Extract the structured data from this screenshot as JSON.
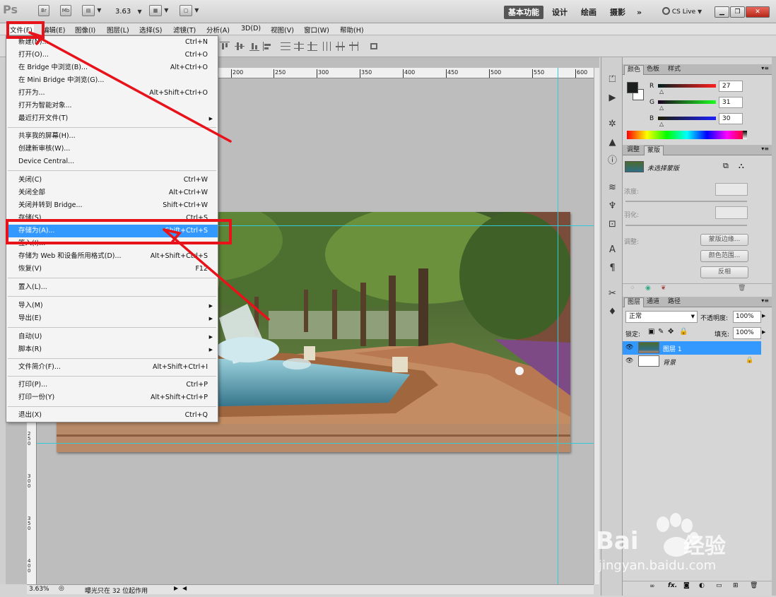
{
  "appbar": {
    "logo": "Ps",
    "br_button": "Br",
    "mb_button": "Mb",
    "zoom": "3.63",
    "workspaces": [
      "基本功能",
      "设计",
      "绘画",
      "摄影"
    ],
    "more": "»",
    "cs_live": "CS Live"
  },
  "menubar": {
    "items": [
      "文件(F)",
      "编辑(E)",
      "图像(I)",
      "图层(L)",
      "选择(S)",
      "滤镜(T)",
      "分析(A)",
      "3D(D)",
      "视图(V)",
      "窗口(W)",
      "帮助(H)"
    ]
  },
  "file_menu": {
    "items": [
      {
        "label": "新建(N)...",
        "shortcut": "Ctrl+N"
      },
      {
        "label": "打开(O)...",
        "shortcut": "Ctrl+O"
      },
      {
        "label": "在 Bridge 中浏览(B)...",
        "shortcut": "Alt+Ctrl+O"
      },
      {
        "label": "在 Mini Bridge 中浏览(G)...",
        "shortcut": ""
      },
      {
        "label": "打开为...",
        "shortcut": "Alt+Shift+Ctrl+O"
      },
      {
        "label": "打开为智能对象...",
        "shortcut": ""
      },
      {
        "label": "最近打开文件(T)",
        "shortcut": "",
        "submenu": true
      },
      {
        "label": "共享我的屏幕(H)...",
        "shortcut": ""
      },
      {
        "label": "创建新审核(W)...",
        "shortcut": ""
      },
      {
        "label": "Device Central...",
        "shortcut": ""
      },
      {
        "label": "关闭(C)",
        "shortcut": "Ctrl+W"
      },
      {
        "label": "关闭全部",
        "shortcut": "Alt+Ctrl+W"
      },
      {
        "label": "关闭并转到 Bridge...",
        "shortcut": "Shift+Ctrl+W"
      },
      {
        "label": "存储(S)",
        "shortcut": "Ctrl+S"
      },
      {
        "label": "存储为(A)...",
        "shortcut": "Shift+Ctrl+S",
        "highlighted": true
      },
      {
        "label": "签入(I)...",
        "shortcut": ""
      },
      {
        "label": "存储为 Web 和设备所用格式(D)...",
        "shortcut": "Alt+Shift+Ctrl+S"
      },
      {
        "label": "恢复(V)",
        "shortcut": "F12"
      },
      {
        "label": "置入(L)...",
        "shortcut": ""
      },
      {
        "label": "导入(M)",
        "shortcut": "",
        "submenu": true
      },
      {
        "label": "导出(E)",
        "shortcut": "",
        "submenu": true
      },
      {
        "label": "自动(U)",
        "shortcut": "",
        "submenu": true
      },
      {
        "label": "脚本(R)",
        "shortcut": "",
        "submenu": true
      },
      {
        "label": "文件简介(F)...",
        "shortcut": "Alt+Shift+Ctrl+I"
      },
      {
        "label": "打印(P)...",
        "shortcut": "Ctrl+P"
      },
      {
        "label": "打印一份(Y)",
        "shortcut": "Alt+Shift+Ctrl+P"
      },
      {
        "label": "退出(X)",
        "shortcut": "Ctrl+Q"
      }
    ]
  },
  "ruler": {
    "h_ticks": [
      "200",
      "250",
      "300",
      "350",
      "400",
      "450",
      "500",
      "550",
      "600"
    ],
    "v_ticks": [
      "2\n5\n0",
      "3\n0\n0",
      "3\n5\n0",
      "4\n0\n0"
    ]
  },
  "status": {
    "zoom": "3.63%",
    "message": "曝光只在 32 位起作用"
  },
  "color_panel": {
    "tabs": [
      "颜色",
      "色板",
      "样式"
    ],
    "r": "27",
    "g": "31",
    "b": "30",
    "r_label": "R",
    "g_label": "G",
    "b_label": "B",
    "fg_color": "#1b1f1e"
  },
  "masks_panel": {
    "tabs": [
      "调整",
      "蒙版"
    ],
    "mask_name": "未选择蒙版",
    "density_label": "浓度:",
    "feather_label": "羽化:",
    "refine_label": "调整:",
    "mask_edge_button": "蒙版边缘...",
    "color_range_button": "颜色范围...",
    "invert_button": "反相"
  },
  "layers_panel": {
    "tabs": [
      "图层",
      "通道",
      "路径"
    ],
    "blend_mode": "正常",
    "opacity_label": "不透明度:",
    "opacity": "100%",
    "lock_label": "锁定:",
    "fill_label": "填充:",
    "fill": "100%",
    "layers": [
      {
        "name": "图层 1",
        "selected": true
      },
      {
        "name": "背景",
        "selected": false,
        "locked": true
      }
    ]
  },
  "watermark": {
    "brand": "Bai",
    "brand2": "经验",
    "url": "jingyan.baidu.com"
  }
}
